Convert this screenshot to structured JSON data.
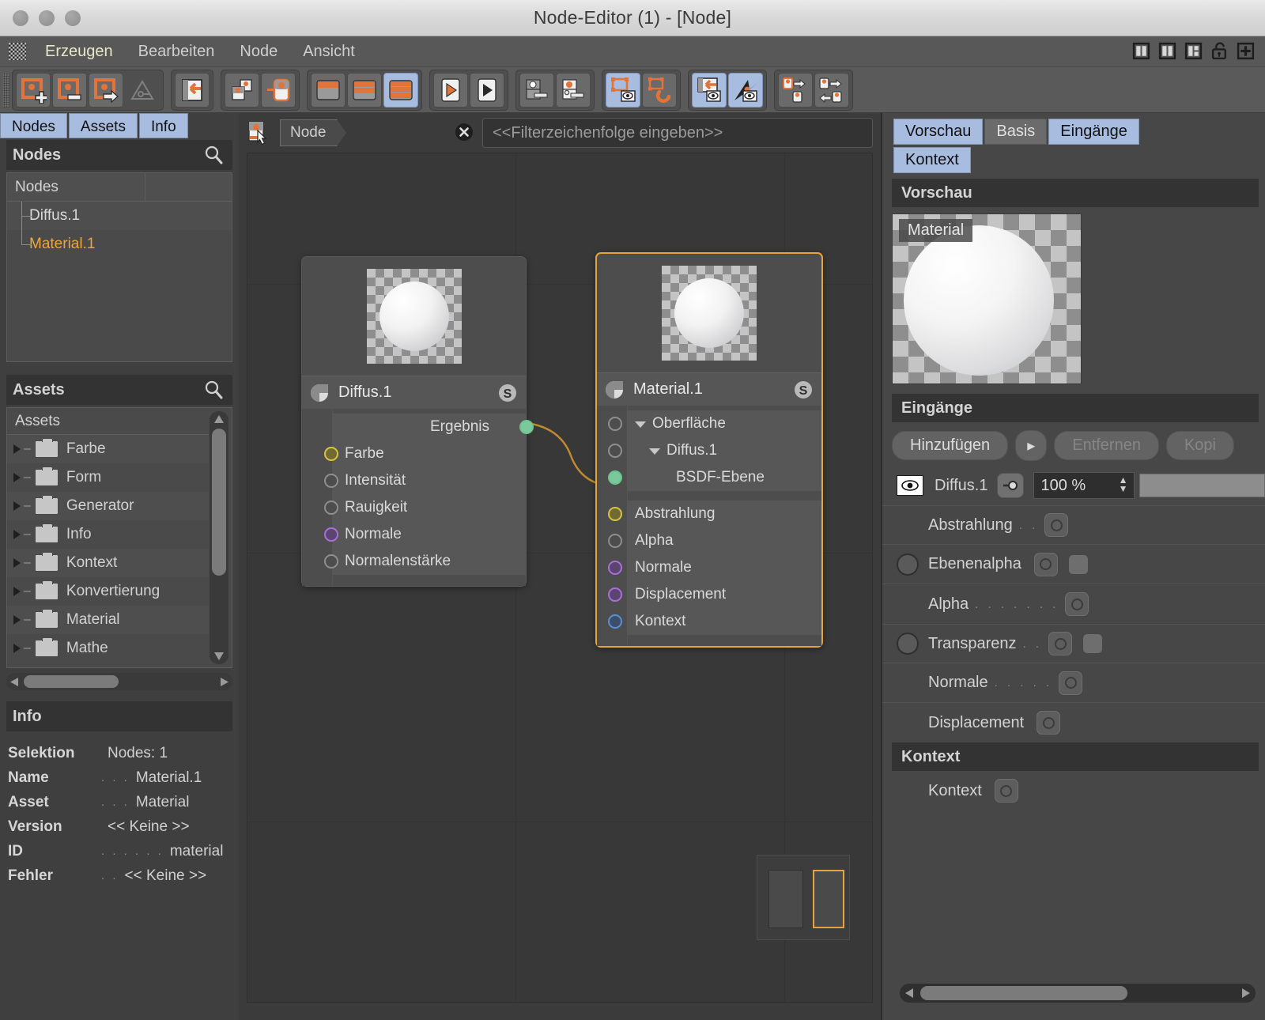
{
  "window": {
    "title": "Node-Editor (1) - [Node]"
  },
  "menu": {
    "items": [
      "Erzeugen",
      "Bearbeiten",
      "Node",
      "Ansicht"
    ],
    "active_index": 0
  },
  "window_icons": [
    "split-vertical-icon",
    "split-columns-icon",
    "split-layout-icon",
    "lock-open-icon",
    "plus-icon"
  ],
  "toolbar": {
    "groups": [
      {
        "buttons": [
          {
            "name": "add-node-icon",
            "selected": false
          },
          {
            "name": "node-minus-icon",
            "selected": false
          },
          {
            "name": "node-arrow-icon",
            "selected": false
          },
          {
            "name": "triangle-disabled-icon",
            "selected": false,
            "disabled": true
          }
        ]
      },
      {
        "buttons": [
          {
            "name": "group-into-icon",
            "selected": false
          }
        ]
      },
      {
        "buttons": [
          {
            "name": "duplicate-nodes-icon",
            "selected": false
          },
          {
            "name": "extract-node-icon",
            "selected": false
          }
        ]
      },
      {
        "buttons": [
          {
            "name": "ports-half-icon",
            "selected": false
          },
          {
            "name": "ports-two-icon",
            "selected": false
          },
          {
            "name": "ports-full-icon",
            "selected": true
          }
        ]
      },
      {
        "buttons": [
          {
            "name": "play-orange-icon",
            "selected": false
          },
          {
            "name": "play-black-icon",
            "selected": false
          }
        ]
      },
      {
        "buttons": [
          {
            "name": "port-white-icon",
            "selected": false
          },
          {
            "name": "port-orange-icon",
            "selected": false
          }
        ]
      },
      {
        "buttons": [
          {
            "name": "frame-eye-icon",
            "selected": true
          },
          {
            "name": "magnet-icon",
            "selected": false
          }
        ]
      },
      {
        "buttons": [
          {
            "name": "layout-eye-icon",
            "selected": true
          },
          {
            "name": "cursor-eye-icon",
            "selected": true
          }
        ]
      },
      {
        "buttons": [
          {
            "name": "nodes-out-icon",
            "selected": false
          },
          {
            "name": "nodes-inout-icon",
            "selected": false
          }
        ]
      }
    ]
  },
  "left_panel": {
    "tabs": [
      "Nodes",
      "Assets",
      "Info"
    ],
    "nodes_section": {
      "header": "Nodes",
      "column_header": "Nodes",
      "rows": [
        {
          "label": "Diffus.1",
          "highlighted": false
        },
        {
          "label": "Material.1",
          "highlighted": true
        }
      ]
    },
    "assets_section": {
      "header": "Assets",
      "column_header": "Assets",
      "rows": [
        "Farbe",
        "Form",
        "Generator",
        "Info",
        "Kontext",
        "Konvertierung",
        "Material",
        "Mathe"
      ]
    },
    "info_section": {
      "header": "Info",
      "rows": [
        {
          "key": "Selektion",
          "dots": "",
          "value": "Nodes: 1"
        },
        {
          "key": "Name",
          "dots": ". . .",
          "value": "Material.1"
        },
        {
          "key": "Asset",
          "dots": ". . .",
          "value": "Material"
        },
        {
          "key": "Version",
          "dots": "",
          "value": "<< Keine >>"
        },
        {
          "key": "ID",
          "dots": ". . . . . .",
          "value": "material"
        },
        {
          "key": "Fehler",
          "dots": ". .",
          "value": "<< Keine >>"
        }
      ]
    }
  },
  "graph": {
    "breadcrumb_icon": "node-cursor-icon",
    "breadcrumb": "Node",
    "filter_clear_icon": "clear-circle-icon",
    "filter_placeholder": "<<Filterzeichenfolge eingeben>>",
    "nodes": [
      {
        "title": "Diffus.1",
        "selected": false,
        "badge": "S",
        "outputs": [
          {
            "label": "Ergebnis",
            "color": "green"
          }
        ],
        "inputs": [
          {
            "label": "Farbe",
            "color": "yellow"
          },
          {
            "label": "Intensität",
            "color": "grey"
          },
          {
            "label": "Rauigkeit",
            "color": "grey"
          },
          {
            "label": "Normale",
            "color": "purple"
          },
          {
            "label": "Normalenstärke",
            "color": "grey"
          }
        ]
      },
      {
        "title": "Material.1",
        "selected": true,
        "badge": "S",
        "tree": [
          {
            "label": "Oberfläche",
            "depth": 0,
            "color": "grey",
            "expander": true
          },
          {
            "label": "Diffus.1",
            "depth": 1,
            "color": "grey",
            "expander": true
          },
          {
            "label": "BSDF-Ebene",
            "depth": 2,
            "color": "green",
            "expander": false
          }
        ],
        "inputs": [
          {
            "label": "Abstrahlung",
            "color": "yellow"
          },
          {
            "label": "Alpha",
            "color": "grey"
          },
          {
            "label": "Normale",
            "color": "purple"
          },
          {
            "label": "Displacement",
            "color": "purple"
          },
          {
            "label": "Kontext",
            "color": "blue"
          }
        ]
      }
    ],
    "minimap": {
      "name": "minimap"
    }
  },
  "right_panel": {
    "tabs": [
      {
        "label": "Vorschau",
        "active": true
      },
      {
        "label": "Basis",
        "active": false
      },
      {
        "label": "Eingänge",
        "active": true
      },
      {
        "label": "Kontext",
        "active": true
      }
    ],
    "preview": {
      "header": "Vorschau",
      "badge": "Material"
    },
    "inputs": {
      "header": "Eingänge",
      "buttons": [
        {
          "label": "Hinzufügen",
          "dim": false
        },
        {
          "label": "▸",
          "dim": false
        },
        {
          "label": "Entfernen",
          "dim": true
        },
        {
          "label": "Kopi",
          "dim": true
        }
      ],
      "layer": {
        "name": "Diffus.1",
        "value": "100 %"
      },
      "rows": [
        {
          "label": "Abstrahlung",
          "dots": ". .",
          "ring": false,
          "swatch": false
        },
        {
          "label": "Ebenenalpha",
          "dots": "",
          "ring": true,
          "swatch": true
        },
        {
          "label": "Alpha",
          "dots": ". . . . . . .",
          "ring": false,
          "swatch": false
        },
        {
          "label": "Transparenz",
          "dots": ". .",
          "ring": true,
          "swatch": true
        },
        {
          "label": "Normale",
          "dots": ". . . . .",
          "ring": false,
          "swatch": false
        },
        {
          "label": "Displacement",
          "dots": "",
          "ring": false,
          "swatch": false
        }
      ]
    },
    "context": {
      "header": "Kontext",
      "rows": [
        {
          "label": "Kontext",
          "dots": "",
          "ring": false,
          "swatch": false
        }
      ]
    }
  },
  "colors": {
    "accent_orange": "#e8a33d",
    "tab_blue": "#a8bce0",
    "port_green": "#79c99a",
    "port_yellow": "#d8c441",
    "port_purple": "#a96fd8",
    "port_blue": "#5b8fd4"
  }
}
